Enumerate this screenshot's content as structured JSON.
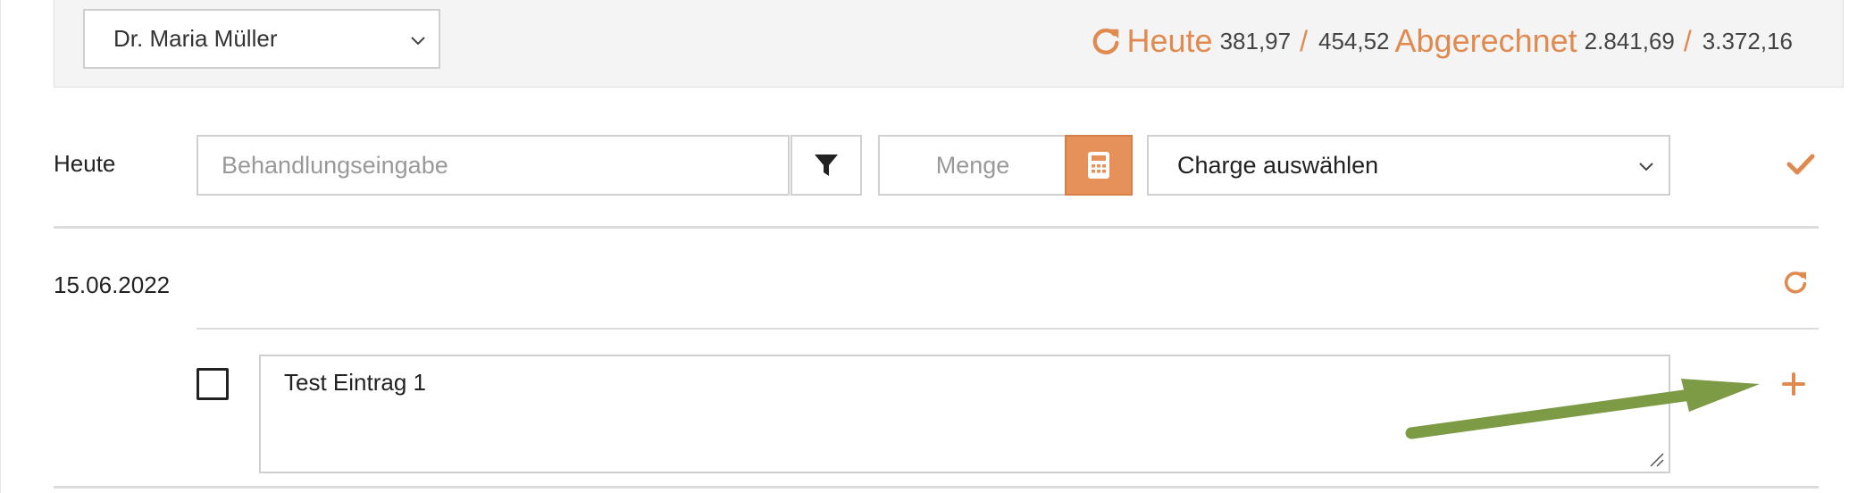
{
  "header": {
    "doctor": "Dr. Maria Müller",
    "totals": {
      "today_label": "Heute",
      "today_value": "381,97",
      "today_total": "454,52",
      "billed_label": "Abgerechnet",
      "billed_value": "2.841,69",
      "billed_total": "3.372,16",
      "separator": "/"
    }
  },
  "entry_row": {
    "label": "Heute",
    "treatment_placeholder": "Behandlungseingabe",
    "quantity_placeholder": "Menge",
    "charge_selected": "Charge auswählen"
  },
  "date_section": {
    "date": "15.06.2022",
    "entries": [
      {
        "text": "Test Eintrag 1",
        "checked": false
      }
    ]
  },
  "colors": {
    "accent": "#e08a50",
    "calc_button": "#e6905a",
    "annotation_arrow": "#7d9a45"
  },
  "icons": [
    "refresh-icon",
    "filter-icon",
    "calculator-icon",
    "checkmark-icon",
    "plus-icon",
    "chevron-down-icon"
  ]
}
